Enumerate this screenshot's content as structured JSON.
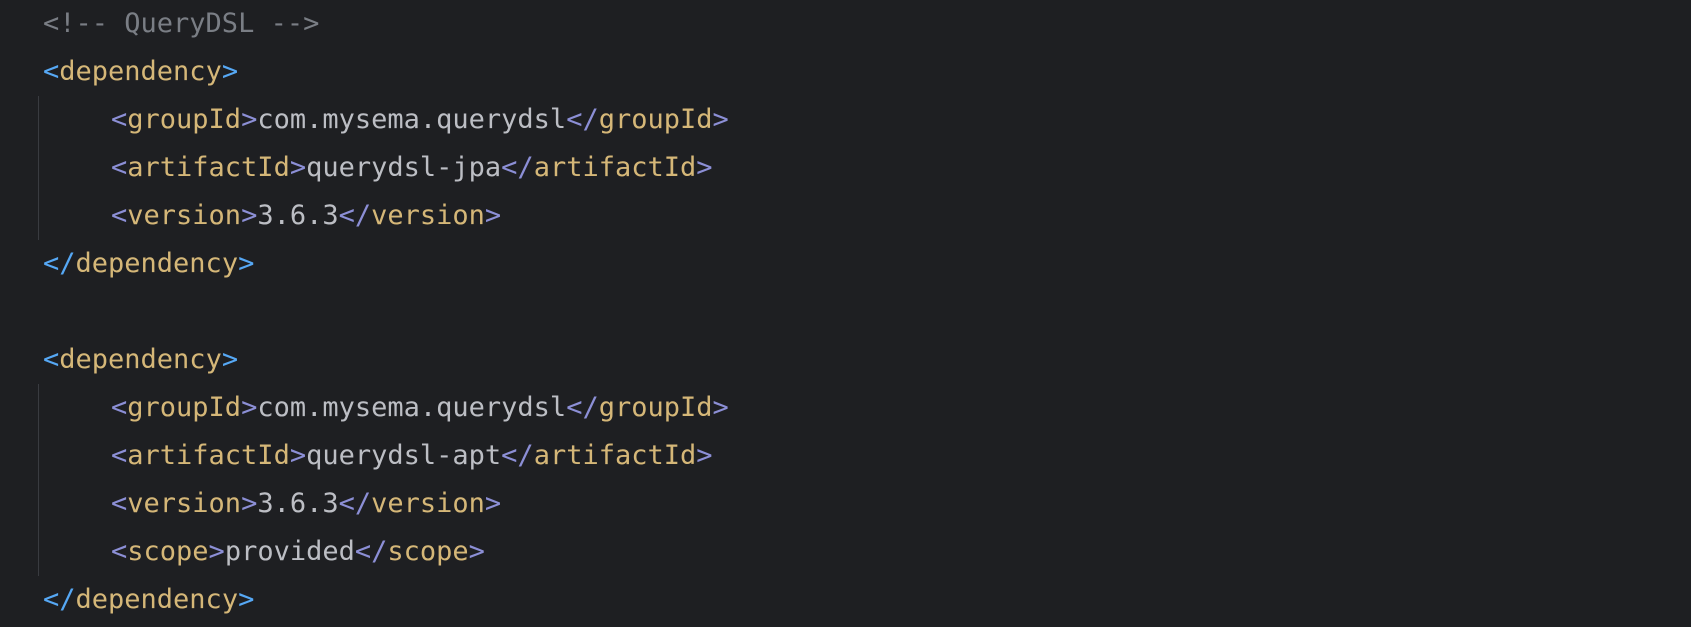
{
  "editor": {
    "comment": "<!-- QueryDSL -->",
    "block1": {
      "open_tag": "dependency",
      "group_tag": "groupId",
      "group_value": "com.mysema.querydsl",
      "artifact_tag": "artifactId",
      "artifact_value": "querydsl-jpa",
      "version_tag": "version",
      "version_value": "3.6.3",
      "close_tag": "dependency"
    },
    "block2": {
      "open_tag": "dependency",
      "group_tag": "groupId",
      "group_value": "com.mysema.querydsl",
      "artifact_tag": "artifactId",
      "artifact_value": "querydsl-apt",
      "version_tag": "version",
      "version_value": "3.6.3",
      "scope_tag": "scope",
      "scope_value": "provided",
      "close_tag": "dependency"
    },
    "punct": {
      "lt": "<",
      "gt": ">",
      "lt_slash": "</"
    },
    "colors": {
      "background": "#1e1f22",
      "comment": "#7a7e85",
      "outer_bracket": "#56a8f5",
      "inner_bracket": "#8c8fd6",
      "tag_name": "#d5b778",
      "text": "#bcbec4"
    }
  }
}
